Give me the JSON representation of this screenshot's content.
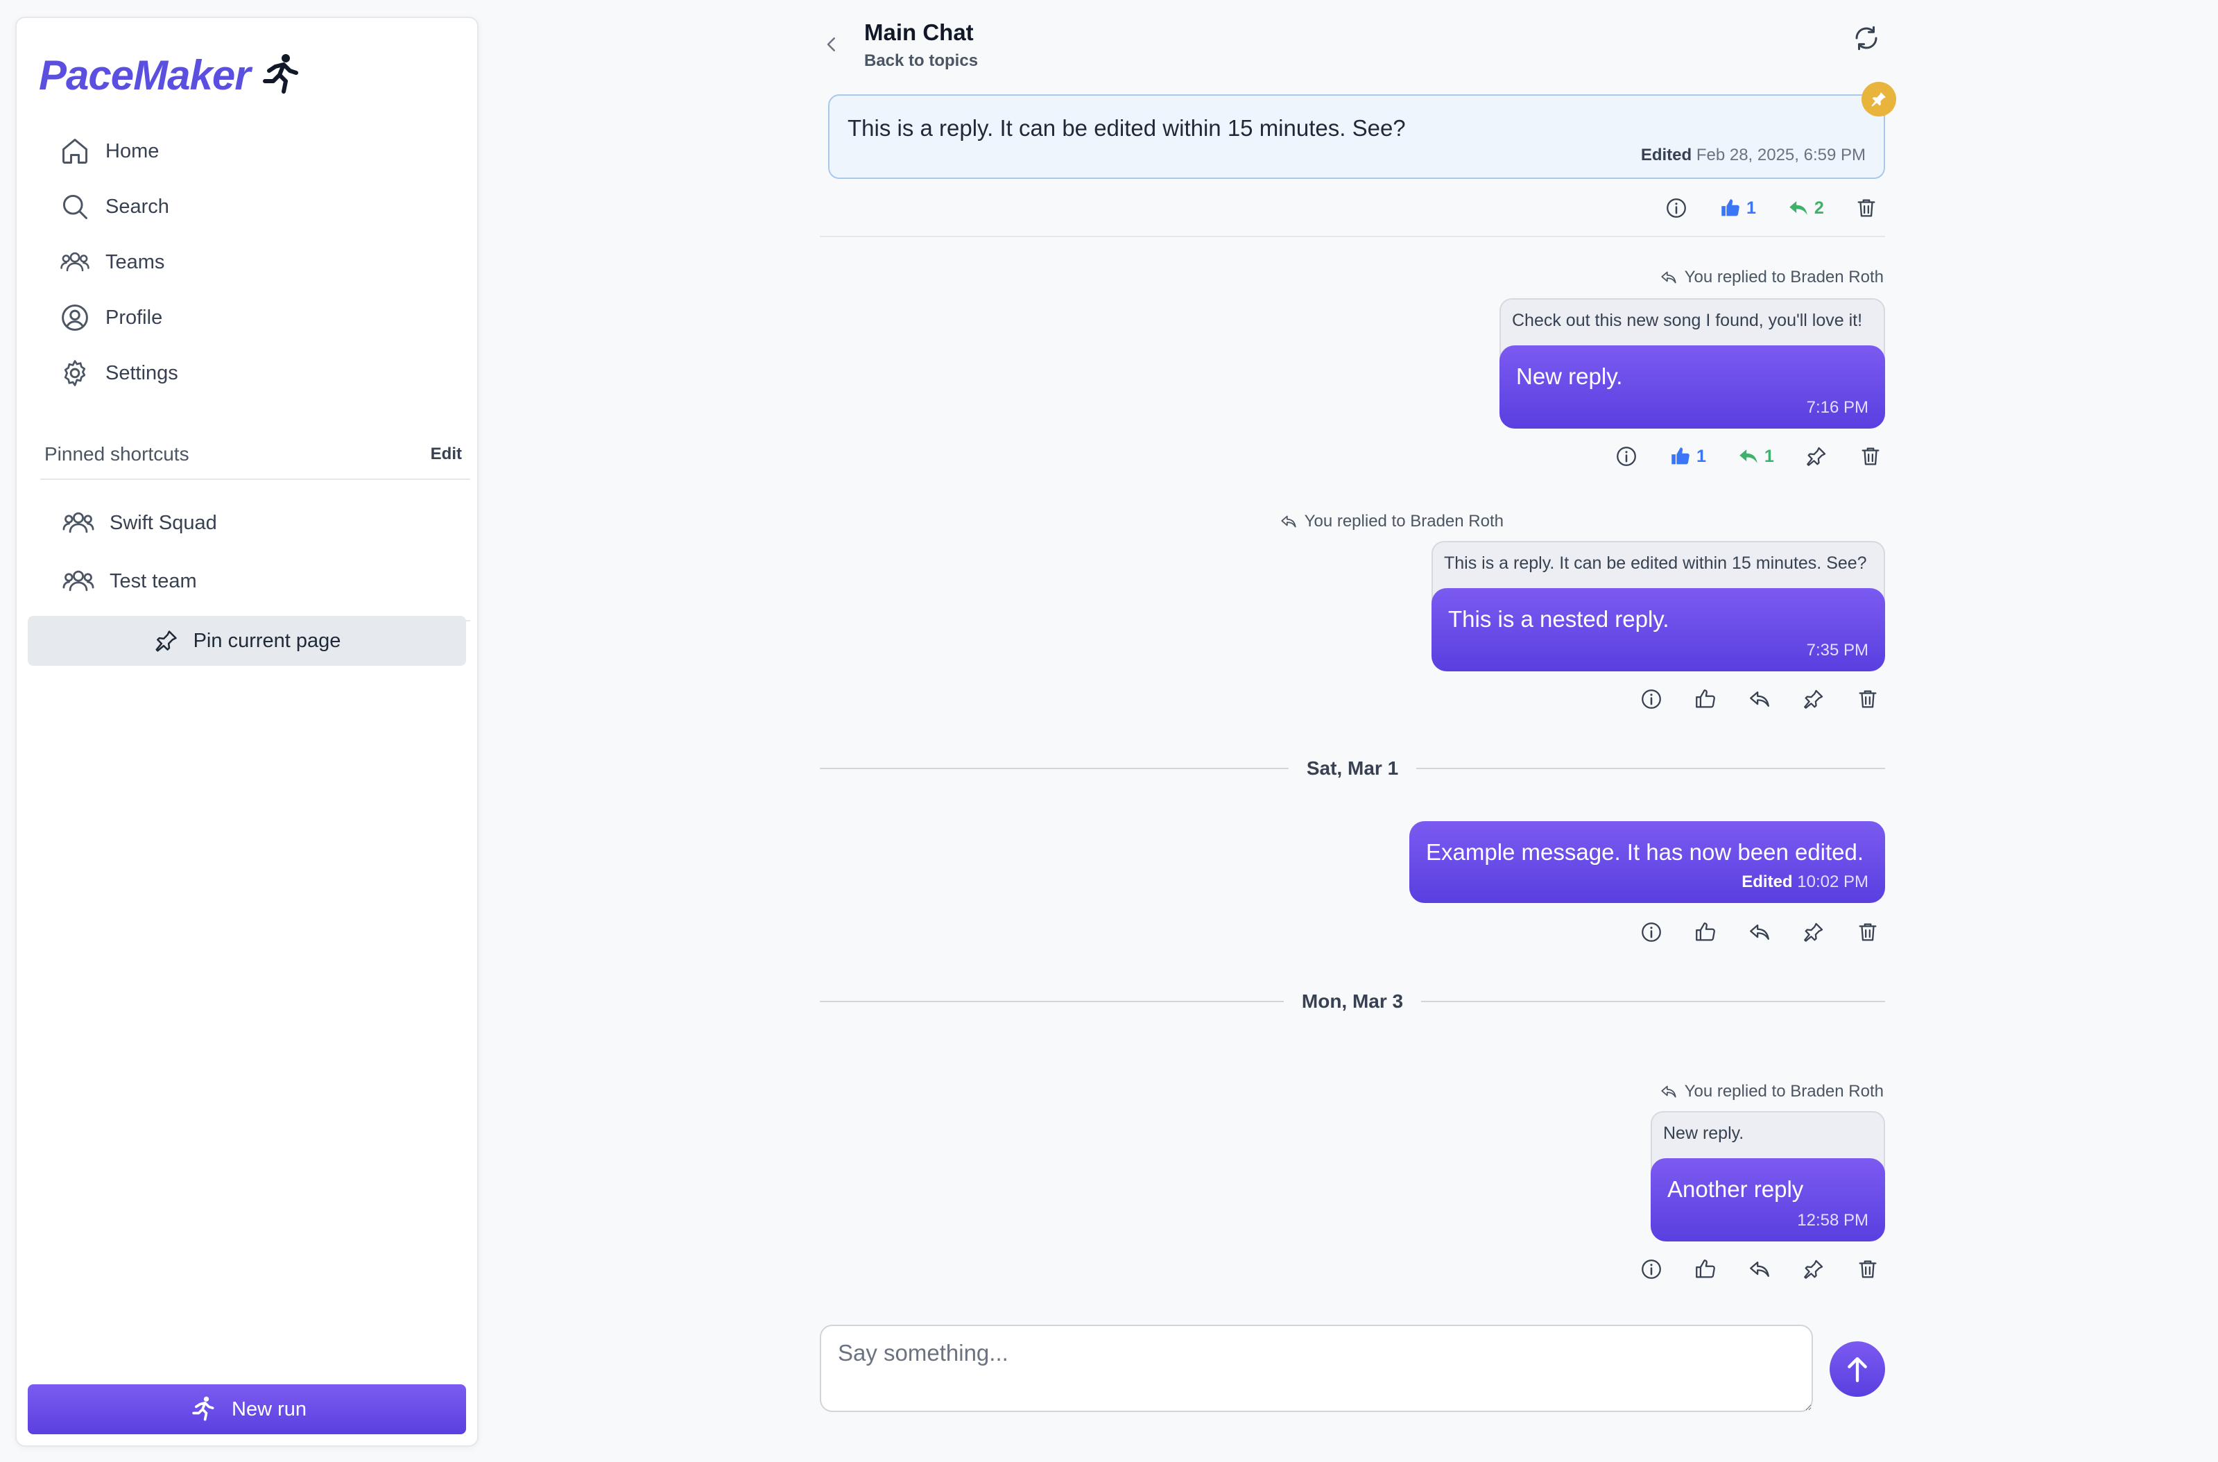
{
  "app": {
    "logo_text": "PaceMaker"
  },
  "sidebar": {
    "nav": [
      {
        "label": "Home",
        "icon": "home-icon"
      },
      {
        "label": "Search",
        "icon": "search-icon"
      },
      {
        "label": "Teams",
        "icon": "users-icon"
      },
      {
        "label": "Profile",
        "icon": "user-circle-icon"
      },
      {
        "label": "Settings",
        "icon": "gear-icon"
      }
    ],
    "pinned_title": "Pinned shortcuts",
    "pinned_edit": "Edit",
    "pinned": [
      {
        "label": "Swift Squad",
        "icon": "users-icon"
      },
      {
        "label": "Test team",
        "icon": "users-icon"
      }
    ],
    "pin_button": "Pin current page",
    "new_run_button": "New run"
  },
  "header": {
    "title": "Main Chat",
    "subtitle": "Back to topics"
  },
  "messages": {
    "pinned": {
      "text": "This is a reply. It can be edited within 15 minutes. See?",
      "edited_label": "Edited",
      "time": "Feb 28, 2025, 6:59 PM",
      "likes": "1",
      "replies": "2"
    },
    "m1": {
      "reply_to": "You replied to Braden Roth",
      "quote": "Check out this new song I found, you'll love it!",
      "text": "New reply.",
      "time": "7:16 PM",
      "likes": "1",
      "replies": "1"
    },
    "m2": {
      "reply_to": "You replied to Braden Roth",
      "quote": "This is a reply. It can be edited within 15 minutes. See?",
      "text": "This is a nested reply.",
      "time": "7:35 PM"
    },
    "date1": "Sat, Mar 1",
    "m3": {
      "text": "Example message. It has now been edited.",
      "edited_label": "Edited",
      "time": "10:02 PM"
    },
    "date2": "Mon, Mar 3",
    "m4": {
      "reply_to": "You replied to Braden Roth",
      "quote": "New reply.",
      "text": "Another reply",
      "time": "12:58 PM"
    }
  },
  "composer": {
    "placeholder": "Say something..."
  },
  "colors": {
    "accent": "#5b3fe0",
    "pin_badge": "#e9b43c",
    "like": "#3b76f6",
    "reply": "#3eb26b"
  }
}
